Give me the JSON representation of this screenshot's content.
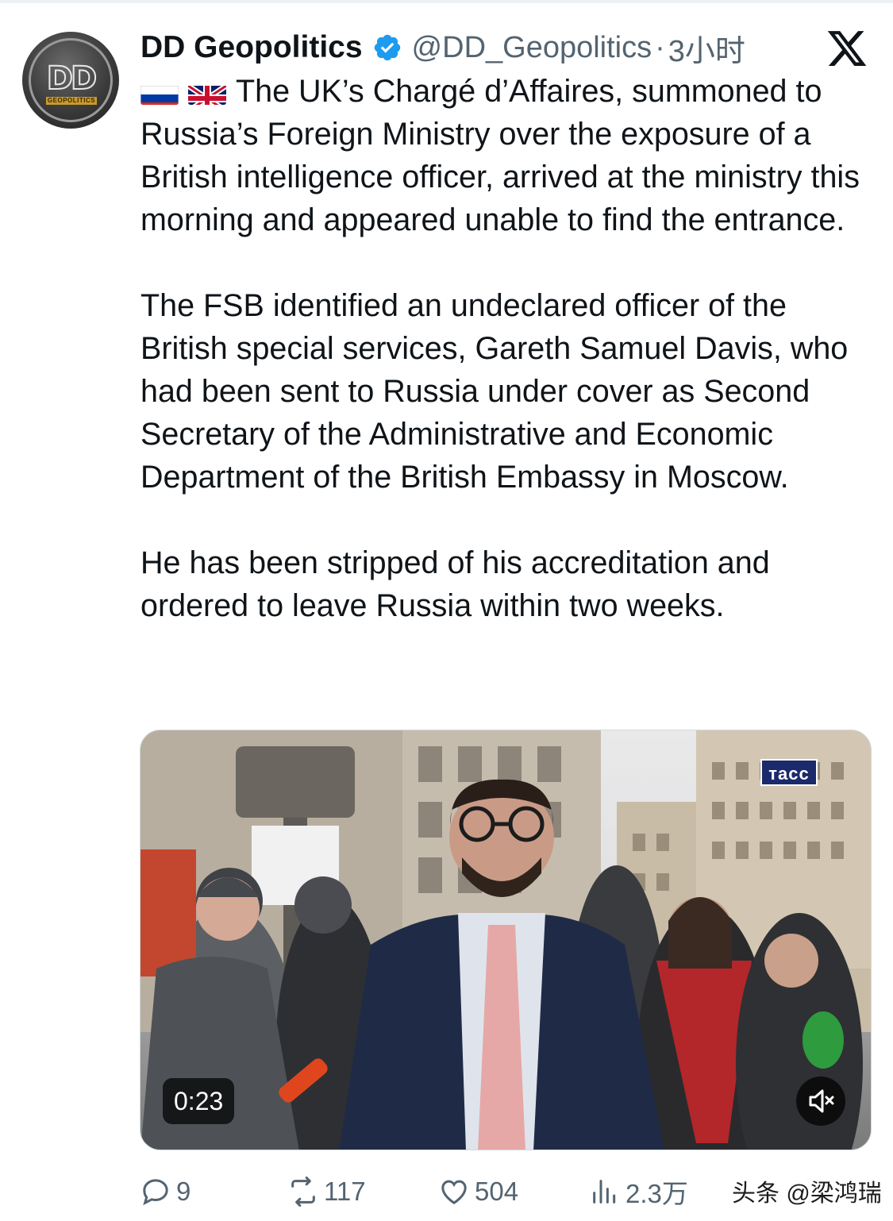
{
  "author": {
    "display_name": "DD Geopolitics",
    "handle": "@DD_Geopolitics",
    "separator": "·",
    "timestamp": "3小时",
    "avatar_monogram": "DD",
    "avatar_subtext": "GEOPOLITICS"
  },
  "tweet": {
    "flags": [
      "russia-flag",
      "uk-flag"
    ],
    "paragraphs": [
      "The UK’s Chargé d’Affaires, summoned to Russia’s Foreign Ministry over the exposure of a British intelligence officer, arrived at the ministry this morning and appeared unable to find the entrance.",
      "The FSB identified an undeclared officer of the British special services, Gareth Samuel Davis, who had been sent to Russia under cover as Second Secretary of the Administrative and Economic Department of the British Embassy in Moscow.",
      "He has been stripped of his accreditation and ordered to leave Russia within two weeks."
    ]
  },
  "media": {
    "type": "video",
    "duration": "0:23",
    "watermark_label": "тасс",
    "muted": true
  },
  "actions": {
    "replies": "9",
    "reposts": "117",
    "likes": "504",
    "views": "2.3万"
  },
  "watermark": "头条 @梁鸿瑞",
  "colors": {
    "text": "#0f1419",
    "secondary": "#536471",
    "verified": "#1d9bf0",
    "border": "#cfd9de"
  }
}
